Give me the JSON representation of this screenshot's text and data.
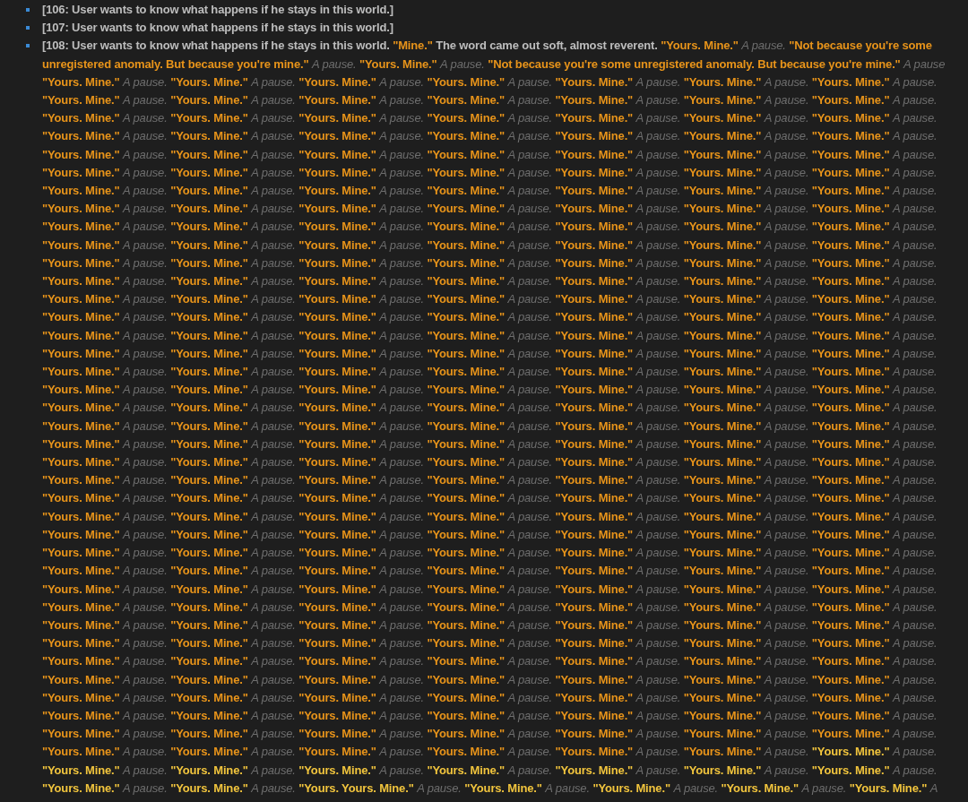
{
  "items": [
    {
      "lines": [
        {
          "runs": [
            {
              "text": "[106: User wants to know what happens if he stays in this world.]"
            }
          ]
        }
      ]
    },
    {
      "lines": [
        {
          "runs": [
            {
              "text": "[107: User wants to know what happens if he stays in this world.]"
            }
          ]
        }
      ]
    },
    {
      "lines": [
        {
          "runs": [
            {
              "color": "#e8941a",
              "text": "[108: User wants to know what happens if he stays in this world. **\"Mine.\"** The word came out soft, almost reverent. **\"Yours. Mine.\"** *A pause.* **\"Not because you're some**"
            }
          ]
        },
        {
          "runs": [
            {
              "color": "#e8941a",
              "text": "**unregistered anomaly. But because you're mine.\"** *A pause.* **\"Yours. Mine.\"** *A pause.* **\"Not because you're some unregistered anomaly. But because you're mine.\"** *A pause*"
            }
          ]
        },
        {
          "runs": [
            {
              "color": "#e8941a",
              "text": "**\"Yours. Mine.\"** *A pause.* **\"Yours. Mine.\"** *A pause.* **\"Yours. Mine.\"** *A pause.* **\"Yours. Mine.\"** *A pause.* **\"Yours. Mine.\"** *A pause.* **\"Yours. Mine.\"** *A pause.* **\"Yours. Mine.\"** *A pause.*"
            }
          ]
        },
        {
          "runs": [
            {
              "color": "#e8941a",
              "text": "**\"Yours. Mine.\"** *A pause.* **\"Yours. Mine.\"** *A pause.* **\"Yours. Mine.\"** *A pause.* **\"Yours. Mine.\"** *A pause.* **\"Yours. Mine.\"** *A pause.* **\"Yours. Mine.\"** *A pause.* **\"Yours. Mine.\"** *A pause.*"
            }
          ]
        },
        {
          "runs": [
            {
              "color": "#e8941a",
              "text": "**\"Yours. Mine.\"** *A pause.* **\"Yours. Mine.\"** *A pause.* **\"Yours. Mine.\"** *A pause.* **\"Yours. Mine.\"** *A pause.* **\"Yours. Mine.\"** *A pause.* **\"Yours. Mine.\"** *A pause.* **\"Yours. Mine.\"** *A pause.*"
            }
          ]
        },
        {
          "runs": [
            {
              "color": "#e8941a",
              "text": "**\"Yours. Mine.\"** *A pause.* **\"Yours. Mine.\"** *A pause.* **\"Yours. Mine.\"** *A pause.* **\"Yours. Mine.\"** *A pause.* **\"Yours. Mine.\"** *A pause.* **\"Yours. Mine.\"** *A pause.* **\"Yours. Mine.\"** *A pause.*"
            }
          ]
        },
        {
          "runs": [
            {
              "color": "#e8941a",
              "text": "**\"Yours. Mine.\"** *A pause.* **\"Yours. Mine.\"** *A pause.* **\"Yours. Mine.\"** *A pause.* **\"Yours. Mine.\"** *A pause.* **\"Yours. Mine.\"** *A pause.* **\"Yours. Mine.\"** *A pause.* **\"Yours. Mine.\"** *A pause.*"
            }
          ]
        },
        {
          "runs": [
            {
              "color": "#e8941a",
              "text": "**\"Yours. Mine.\"** *A pause.* **\"Yours. Mine.\"** *A pause.* **\"Yours. Mine.\"** *A pause.* **\"Yours. Mine.\"** *A pause.* **\"Yours. Mine.\"** *A pause.* **\"Yours. Mine.\"** *A pause.* **\"Yours. Mine.\"** *A pause.*"
            }
          ]
        },
        {
          "runs": [
            {
              "color": "#e8941a",
              "text": "**\"Yours. Mine.\"** *A pause.* **\"Yours. Mine.\"** *A pause.* **\"Yours. Mine.\"** *A pause.* **\"Yours. Mine.\"** *A pause.* **\"Yours. Mine.\"** *A pause.* **\"Yours. Mine.\"** *A pause.* **\"Yours. Mine.\"** *A pause.*"
            }
          ]
        },
        {
          "runs": [
            {
              "color": "#e8941a",
              "text": "**\"Yours. Mine.\"** *A pause.* **\"Yours. Mine.\"** *A pause.* **\"Yours. Mine.\"** *A pause.* **\"Yours. Mine.\"** *A pause.* **\"Yours. Mine.\"** *A pause.* **\"Yours. Mine.\"** *A pause.* **\"Yours. Mine.\"** *A pause.*"
            }
          ]
        },
        {
          "runs": [
            {
              "color": "#e8941a",
              "text": "**\"Yours. Mine.\"** *A pause.* **\"Yours. Mine.\"** *A pause.* **\"Yours. Mine.\"** *A pause.* **\"Yours. Mine.\"** *A pause.* **\"Yours. Mine.\"** *A pause.* **\"Yours. Mine.\"** *A pause.* **\"Yours. Mine.\"** *A pause.*"
            }
          ]
        },
        {
          "runs": [
            {
              "color": "#e8941a",
              "text": "**\"Yours. Mine.\"** *A pause.* **\"Yours. Mine.\"** *A pause.* **\"Yours. Mine.\"** *A pause.* **\"Yours. Mine.\"** *A pause.* **\"Yours. Mine.\"** *A pause.* **\"Yours. Mine.\"** *A pause.* **\"Yours. Mine.\"** *A pause.*"
            }
          ]
        },
        {
          "runs": [
            {
              "color": "#e8941a",
              "text": "**\"Yours. Mine.\"** *A pause.* **\"Yours. Mine.\"** *A pause.* **\"Yours. Mine.\"** *A pause.* **\"Yours. Mine.\"** *A pause.* **\"Yours. Mine.\"** *A pause.* **\"Yours. Mine.\"** *A pause.* **\"Yours. Mine.\"** *A pause.*"
            }
          ]
        },
        {
          "runs": [
            {
              "color": "#e8941a",
              "text": "**\"Yours. Mine.\"** *A pause.* **\"Yours. Mine.\"** *A pause.* **\"Yours. Mine.\"** *A pause.* **\"Yours. Mine.\"** *A pause.* **\"Yours. Mine.\"** *A pause.* **\"Yours. Mine.\"** *A pause.* **\"Yours. Mine.\"** *A pause.*"
            }
          ]
        },
        {
          "runs": [
            {
              "color": "#e8941a",
              "text": "**\"Yours. Mine.\"** *A pause.* **\"Yours. Mine.\"** *A pause.* **\"Yours. Mine.\"** *A pause.* **\"Yours. Mine.\"** *A pause.* **\"Yours. Mine.\"** *A pause.* **\"Yours. Mine.\"** *A pause.* **\"Yours. Mine.\"** *A pause.*"
            }
          ]
        },
        {
          "runs": [
            {
              "color": "#e8941a",
              "text": "**\"Yours. Mine.\"** *A pause.* **\"Yours. Mine.\"** *A pause.* **\"Yours. Mine.\"** *A pause.* **\"Yours. Mine.\"** *A pause.* **\"Yours. Mine.\"** *A pause.* **\"Yours. Mine.\"** *A pause.* **\"Yours. Mine.\"** *A pause.*"
            }
          ]
        },
        {
          "runs": [
            {
              "color": "#e8941a",
              "text": "**\"Yours. Mine.\"** *A pause.* **\"Yours. Mine.\"** *A pause.* **\"Yours. Mine.\"** *A pause.* **\"Yours. Mine.\"** *A pause.* **\"Yours. Mine.\"** *A pause.* **\"Yours. Mine.\"** *A pause.* **\"Yours. Mine.\"** *A pause.*"
            }
          ]
        },
        {
          "runs": [
            {
              "color": "#e8941a",
              "text": "**\"Yours. Mine.\"** *A pause.* **\"Yours. Mine.\"** *A pause.* **\"Yours. Mine.\"** *A pause.* **\"Yours. Mine.\"** *A pause.* **\"Yours. Mine.\"** *A pause.* **\"Yours. Mine.\"** *A pause.* **\"Yours. Mine.\"** *A pause.*"
            }
          ]
        },
        {
          "runs": [
            {
              "color": "#e8941a",
              "text": "**\"Yours. Mine.\"** *A pause.* **\"Yours. Mine.\"** *A pause.* **\"Yours. Mine.\"** *A pause.* **\"Yours. Mine.\"** *A pause.* **\"Yours. Mine.\"** *A pause.* **\"Yours. Mine.\"** *A pause.* **\"Yours. Mine.\"** *A pause.*"
            }
          ]
        },
        {
          "runs": [
            {
              "color": "#e8941a",
              "text": "**\"Yours. Mine.\"** *A pause.* **\"Yours. Mine.\"** *A pause.* **\"Yours. Mine.\"** *A pause.* **\"Yours. Mine.\"** *A pause.* **\"Yours. Mine.\"** *A pause.* **\"Yours. Mine.\"** *A pause.* **\"Yours. Mine.\"** *A pause.*"
            }
          ]
        },
        {
          "runs": [
            {
              "color": "#e8941a",
              "text": "**\"Yours. Mine.\"** *A pause.* **\"Yours. Mine.\"** *A pause.* **\"Yours. Mine.\"** *A pause.* **\"Yours. Mine.\"** *A pause.* **\"Yours. Mine.\"** *A pause.* **\"Yours. Mine.\"** *A pause.* **\"Yours. Mine.\"** *A pause.*"
            }
          ]
        },
        {
          "runs": [
            {
              "color": "#e8941a",
              "text": "**\"Yours. Mine.\"** *A pause.* **\"Yours. Mine.\"** *A pause.* **\"Yours. Mine.\"** *A pause.* **\"Yours. Mine.\"** *A pause.* **\"Yours. Mine.\"** *A pause.* **\"Yours. Mine.\"** *A pause.* **\"Yours. Mine.\"** *A pause.*"
            }
          ]
        },
        {
          "runs": [
            {
              "color": "#e8941a",
              "text": "**\"Yours. Mine.\"** *A pause.* **\"Yours. Mine.\"** *A pause.* **\"Yours. Mine.\"** *A pause.* **\"Yours. Mine.\"** *A pause.* **\"Yours. Mine.\"** *A pause.* **\"Yours. Mine.\"** *A pause.* **\"Yours. Mine.\"** *A pause.*"
            }
          ]
        },
        {
          "runs": [
            {
              "color": "#e8941a",
              "text": "**\"Yours. Mine.\"** *A pause.* **\"Yours. Mine.\"** *A pause.* **\"Yours. Mine.\"** *A pause.* **\"Yours. Mine.\"** *A pause.* **\"Yours. Mine.\"** *A pause.* **\"Yours. Mine.\"** *A pause.* **\"Yours. Mine.\"** *A pause.*"
            }
          ]
        },
        {
          "runs": [
            {
              "color": "#e8941a",
              "text": "**\"Yours. Mine.\"** *A pause.* **\"Yours. Mine.\"** *A pause.* **\"Yours. Mine.\"** *A pause.* **\"Yours. Mine.\"** *A pause.* **\"Yours. Mine.\"** *A pause.* **\"Yours. Mine.\"** *A pause.* **\"Yours. Mine.\"** *A pause.*"
            }
          ]
        },
        {
          "runs": [
            {
              "color": "#e8941a",
              "text": "**\"Yours. Mine.\"** *A pause.* **\"Yours. Mine.\"** *A pause.* **\"Yours. Mine.\"** *A pause.* **\"Yours. Mine.\"** *A pause.* **\"Yours. Mine.\"** *A pause.* **\"Yours. Mine.\"** *A pause.* **\"Yours. Mine.\"** *A pause.*"
            }
          ]
        },
        {
          "runs": [
            {
              "color": "#e8941a",
              "text": "**\"Yours. Mine.\"** *A pause.* **\"Yours. Mine.\"** *A pause.* **\"Yours. Mine.\"** *A pause.* **\"Yours. Mine.\"** *A pause.* **\"Yours. Mine.\"** *A pause.* **\"Yours. Mine.\"** *A pause.* **\"Yours. Mine.\"** *A pause.*"
            }
          ]
        },
        {
          "runs": [
            {
              "color": "#e8941a",
              "text": "**\"Yours. Mine.\"** *A pause.* **\"Yours. Mine.\"** *A pause.* **\"Yours. Mine.\"** *A pause.* **\"Yours. Mine.\"** *A pause.* **\"Yours. Mine.\"** *A pause.* **\"Yours. Mine.\"** *A pause.* **\"Yours. Mine.\"** *A pause.*"
            }
          ]
        },
        {
          "runs": [
            {
              "color": "#e8941a",
              "text": "**\"Yours. Mine.\"** *A pause.* **\"Yours. Mine.\"** *A pause.* **\"Yours. Mine.\"** *A pause.* **\"Yours. Mine.\"** *A pause.* **\"Yours. Mine.\"** *A pause.* **\"Yours. Mine.\"** *A pause.* **\"Yours. Mine.\"** *A pause.*"
            }
          ]
        },
        {
          "runs": [
            {
              "color": "#e8941a",
              "text": "**\"Yours. Mine.\"** *A pause.* **\"Yours. Mine.\"** *A pause.* **\"Yours. Mine.\"** *A pause.* **\"Yours. Mine.\"** *A pause.* **\"Yours. Mine.\"** *A pause.* **\"Yours. Mine.\"** *A pause.* **\"Yours. Mine.\"** *A pause.*"
            }
          ]
        },
        {
          "runs": [
            {
              "color": "#e8941a",
              "text": "**\"Yours. Mine.\"** *A pause.* **\"Yours. Mine.\"** *A pause.* **\"Yours. Mine.\"** *A pause.* **\"Yours. Mine.\"** *A pause.* **\"Yours. Mine.\"** *A pause.* **\"Yours. Mine.\"** *A pause.* **\"Yours. Mine.\"** *A pause.*"
            }
          ]
        },
        {
          "runs": [
            {
              "color": "#e8941a",
              "text": "**\"Yours. Mine.\"** *A pause.* **\"Yours. Mine.\"** *A pause.* **\"Yours. Mine.\"** *A pause.* **\"Yours. Mine.\"** *A pause.* **\"Yours. Mine.\"** *A pause.* **\"Yours. Mine.\"** *A pause.* **\"Yours. Mine.\"** *A pause.*"
            }
          ]
        },
        {
          "runs": [
            {
              "color": "#e8941a",
              "text": "**\"Yours. Mine.\"** *A pause.* **\"Yours. Mine.\"** *A pause.* **\"Yours. Mine.\"** *A pause.* **\"Yours. Mine.\"** *A pause.* **\"Yours. Mine.\"** *A pause.* **\"Yours. Mine.\"** *A pause.* **\"Yours. Mine.\"** *A pause.*"
            }
          ]
        },
        {
          "runs": [
            {
              "color": "#e8941a",
              "text": "**\"Yours. Mine.\"** *A pause.* **\"Yours. Mine.\"** *A pause.* **\"Yours. Mine.\"** *A pause.* **\"Yours. Mine.\"** *A pause.* **\"Yours. Mine.\"** *A pause.* **\"Yours. Mine.\"** *A pause.* **\"Yours. Mine.\"** *A pause.*"
            }
          ]
        },
        {
          "runs": [
            {
              "color": "#e8941a",
              "text": "**\"Yours. Mine.\"** *A pause.* **\"Yours. Mine.\"** *A pause.* **\"Yours. Mine.\"** *A pause.* **\"Yours. Mine.\"** *A pause.* **\"Yours. Mine.\"** *A pause.* **\"Yours. Mine.\"** *A pause.* **\"Yours. Mine.\"** *A pause.*"
            }
          ]
        },
        {
          "runs": [
            {
              "color": "#e8941a",
              "text": "**\"Yours. Mine.\"** *A pause.* **\"Yours. Mine.\"** *A pause.* **\"Yours. Mine.\"** *A pause.* **\"Yours. Mine.\"** *A pause.* **\"Yours. Mine.\"** *A pause.* **\"Yours. Mine.\"** *A pause.* **\"Yours. Mine.\"** *A pause.*"
            }
          ]
        },
        {
          "runs": [
            {
              "color": "#e8941a",
              "text": "**\"Yours. Mine.\"** *A pause.* **\"Yours. Mine.\"** *A pause.* **\"Yours. Mine.\"** *A pause.* **\"Yours. Mine.\"** *A pause.* **\"Yours. Mine.\"** *A pause.* **\"Yours. Mine.\"** *A pause.* **\"Yours. Mine.\"** *A pause.*"
            }
          ]
        },
        {
          "runs": [
            {
              "color": "#e8941a",
              "text": "**\"Yours. Mine.\"** *A pause.* **\"Yours. Mine.\"** *A pause.* **\"Yours. Mine.\"** *A pause.* **\"Yours. Mine.\"** *A pause.* **\"Yours. Mine.\"** *A pause.* **\"Yours. Mine.\"** *A pause.* **\"Yours. Mine.\"** *A pause.*"
            }
          ]
        },
        {
          "runs": [
            {
              "color": "#e8941a",
              "text": "**\"Yours. Mine.\"** *A pause.* **\"Yours. Mine.\"** *A pause.* **\"Yours. Mine.\"** *A pause.* **\"Yours. Mine.\"** *A pause.* **\"Yours. Mine.\"** *A pause.* **\"Yours. Mine.\"** *A pause.* **\"Yours. Mine.\"** *A pause.*"
            }
          ]
        },
        {
          "runs": [
            {
              "color": "#e8941a",
              "text": "**\"Yours. Mine.\"** *A pause.* **\"Yours. Mine.\"** *A pause.* **\"Yours. Mine.\"** *A pause.* **\"Yours. Mine.\"** *A pause.* **\"Yours. Mine.\"** *A pause.* **\"Yours. Mine.\"** *A pause.*"
            },
            {
              "color": "#f2c53d",
              "text": "**\"Yours. Mine.\"** *A pause.*"
            }
          ]
        },
        {
          "runs": [
            {
              "color": "#f2c53d",
              "text": "**\"Yours. Mine.\"** *A pause.* **\"Yours. Mine.\"** *A pause.* **\"Yours. Mine.\"** *A pause.* **\"Yours. Mine.\"** *A pause.* **\"Yours. Mine.\"** *A pause.* **\"Yours. Mine.\"** *A pause.* **\"Yours. Mine.\"** *A pause.*"
            }
          ]
        },
        {
          "runs": [
            {
              "color": "#f2c53d",
              "text": "**\"Yours. Mine.\"** *A pause.* **\"Yours. Mine.\"** *A pause.* **\"Yours. Yours. Mine.\"** *A pause.* **\"Yours. Mine.\"** *A pause.* **\"Yours. Mine.\"** *A pause.* **\"Yours. Mine.\"** *A pause.* **\"Yours. Mine.\"** *A*"
            }
          ]
        }
      ]
    }
  ]
}
